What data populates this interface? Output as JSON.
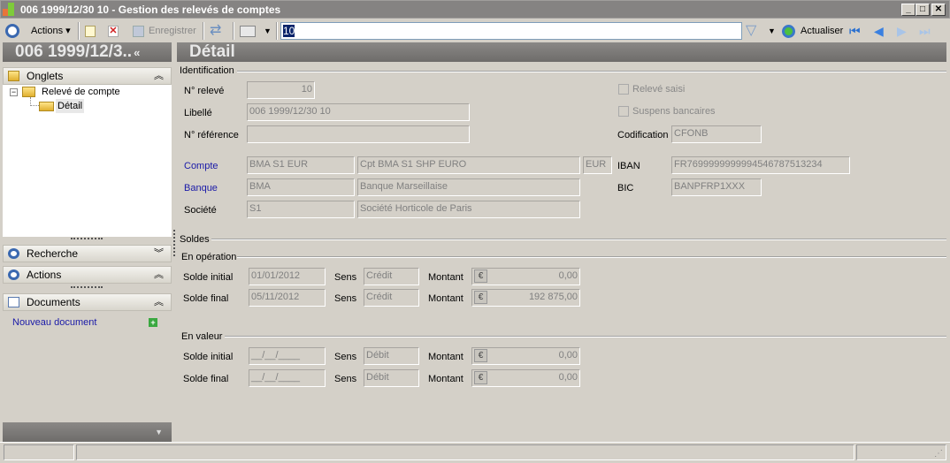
{
  "window": {
    "title": "006 1999/12/30 10 -  Gestion des relevés de comptes"
  },
  "toolbar": {
    "actions": "Actions",
    "save": "Enregistrer",
    "search_value": "10",
    "refresh": "Actualiser"
  },
  "left": {
    "header": "006 1999/12/3..",
    "collapse": "«",
    "tabs_label": "Onglets",
    "tree": [
      {
        "label": "Relevé de compte"
      },
      {
        "label": "Détail"
      }
    ],
    "search_label": "Recherche",
    "actions_label": "Actions",
    "documents_label": "Documents",
    "new_document": "Nouveau document"
  },
  "main": {
    "title": "Détail",
    "identification": {
      "legend": "Identification",
      "num_releve_label": "N° relevé",
      "num_releve": "10",
      "libelle_label": "Libellé",
      "libelle": "006 1999/12/30 10",
      "ref_label": "N° référence",
      "ref": "",
      "releve_saisi": "Relevé saisi",
      "suspens": "Suspens bancaires",
      "codif_label": "Codification",
      "codif": "CFONB",
      "compte_label": "Compte",
      "compte_code": "BMA S1 EUR",
      "compte_name": "Cpt BMA S1 SHP EURO",
      "devise": "EUR",
      "iban_label": "IBAN",
      "iban": "FR7699999999994546787513234",
      "banque_label": "Banque",
      "banque_code": "BMA",
      "banque_name": "Banque Marseillaise",
      "bic_label": "BIC",
      "bic": "BANPFRP1XXX",
      "societe_label": "Société",
      "societe_code": "S1",
      "societe_name": "Société Horticole de Paris"
    },
    "soldes": {
      "legend": "Soldes",
      "operation": {
        "legend": "En opération",
        "rows": [
          {
            "label": "Solde initial",
            "date": "01/01/2012",
            "sens_label": "Sens",
            "sens": "Crédit",
            "montant_label": "Montant",
            "montant": "0,00"
          },
          {
            "label": "Solde final",
            "date": "05/11/2012",
            "sens_label": "Sens",
            "sens": "Crédit",
            "montant_label": "Montant",
            "montant": "192 875,00"
          }
        ]
      },
      "valeur": {
        "legend": "En valeur",
        "rows": [
          {
            "label": "Solde initial",
            "date": "__/__/____",
            "sens_label": "Sens",
            "sens": "Débit",
            "montant_label": "Montant",
            "montant": "0,00"
          },
          {
            "label": "Solde final",
            "date": "__/__/____",
            "sens_label": "Sens",
            "sens": "Débit",
            "montant_label": "Montant",
            "montant": "0,00"
          }
        ]
      }
    },
    "currency_symbol": "€"
  }
}
